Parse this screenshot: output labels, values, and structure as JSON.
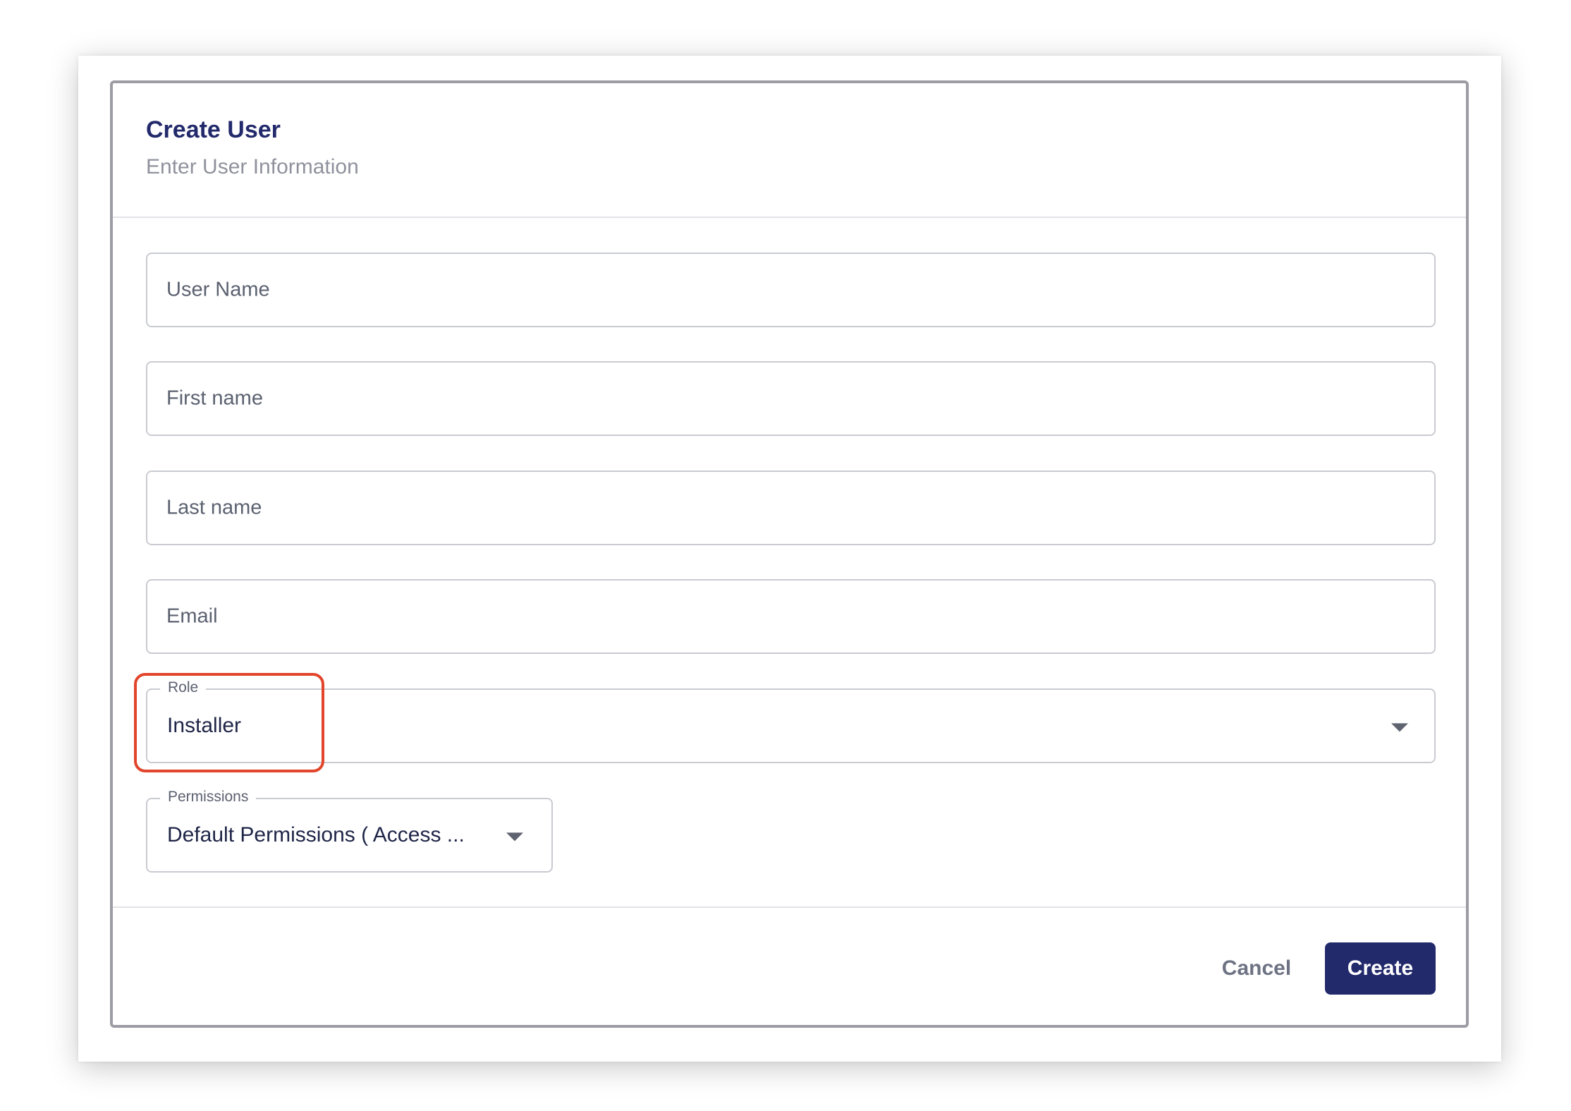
{
  "dialog": {
    "title": "Create User",
    "subtitle": "Enter User Information"
  },
  "form": {
    "user_name": {
      "placeholder": "User Name",
      "value": ""
    },
    "first_name": {
      "placeholder": "First name",
      "value": ""
    },
    "last_name": {
      "placeholder": "Last name",
      "value": ""
    },
    "email": {
      "placeholder": "Email",
      "value": ""
    },
    "role": {
      "label": "Role",
      "value": "Installer"
    },
    "permissions": {
      "label": "Permissions",
      "value": "Default Permissions ( Access ..."
    }
  },
  "actions": {
    "cancel_label": "Cancel",
    "create_label": "Create"
  },
  "colors": {
    "accent": "#232a6b",
    "highlight": "#e2452b",
    "border": "#c9cbd1"
  },
  "icons": {
    "role_dropdown": "caret-down-icon",
    "permissions_dropdown": "caret-down-icon"
  }
}
